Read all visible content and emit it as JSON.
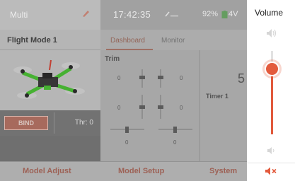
{
  "status_bar": {
    "model_name": "Multi",
    "clock": "17:42:35",
    "battery_percent": "92%",
    "battery_voltage": "4V",
    "icons": [
      "pencil-icon",
      "signal-icon",
      "battery-icon"
    ]
  },
  "flight_mode": "Flight Mode 1",
  "tabs": [
    {
      "label": "Dashboard",
      "selected": true
    },
    {
      "label": "Monitor",
      "selected": false
    }
  ],
  "bind_button": "BIND",
  "throttle": "Thr: 0",
  "trim": {
    "title": "Trim",
    "values": [
      "0",
      "0",
      "0",
      "0",
      "0",
      "0"
    ]
  },
  "timer": {
    "label": "Timer 1",
    "value": "5"
  },
  "bottom_nav": [
    "Model Adjust",
    "Model Setup",
    "System"
  ],
  "volume": {
    "title": "Volume",
    "level": 0.78,
    "icons": [
      "volume-up-icon",
      "volume-down-icon",
      "mute-icon"
    ]
  },
  "colors": {
    "accent": "#e35b3d",
    "dim_accent": "#9a5b4f",
    "drone_green": "#3fae2a"
  }
}
